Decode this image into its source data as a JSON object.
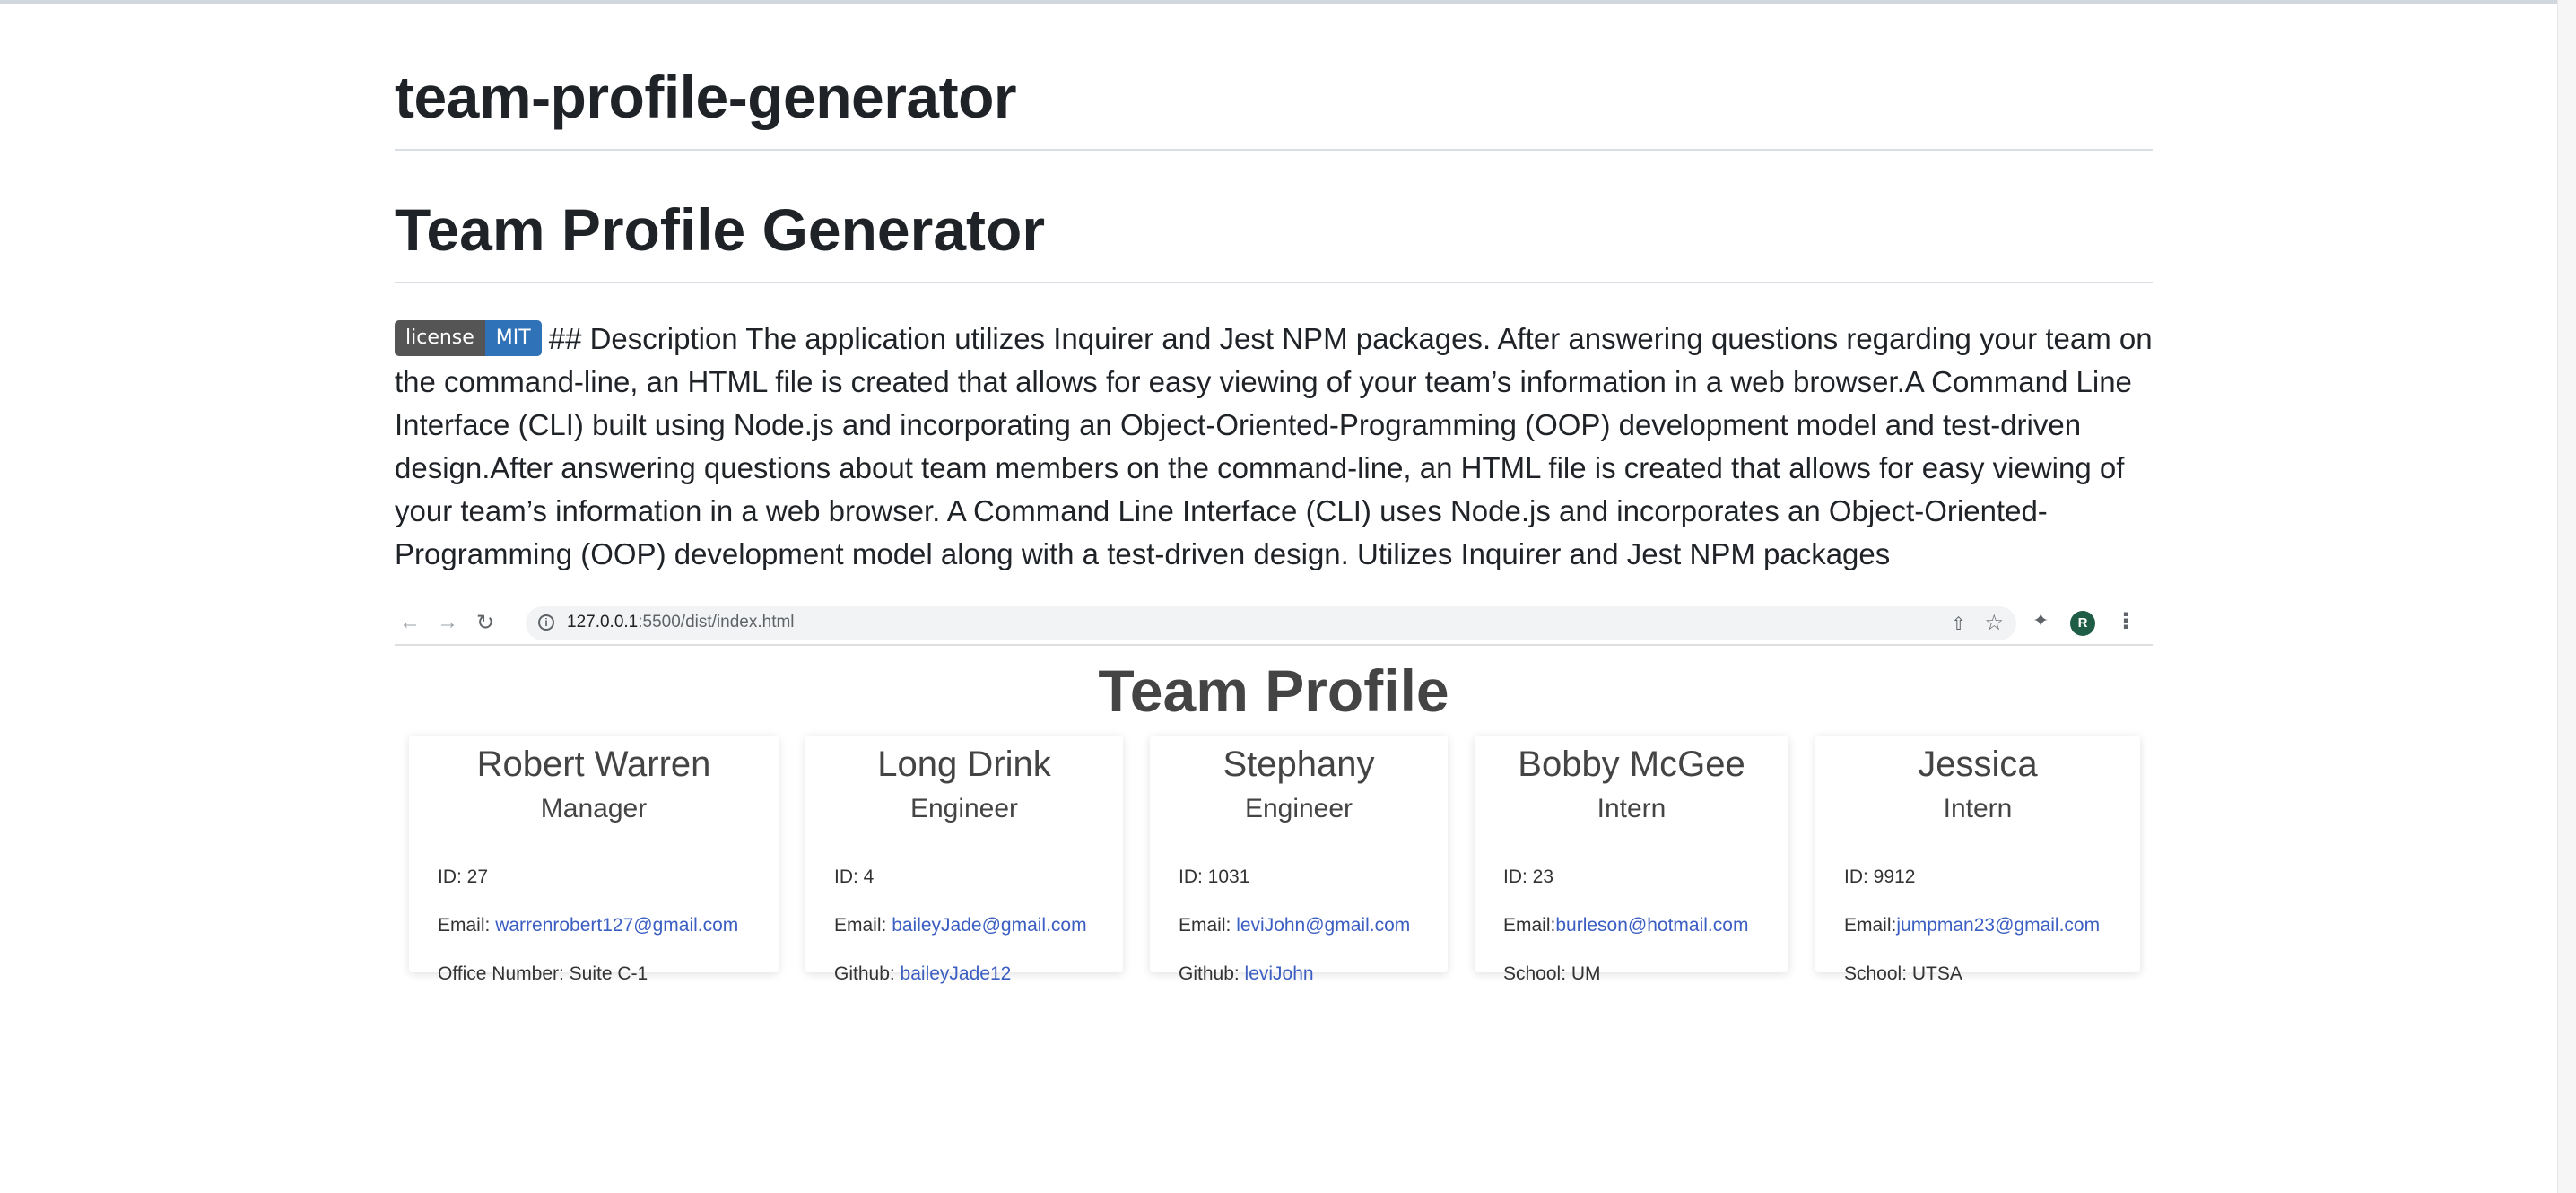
{
  "repo": {
    "title": "team-profile-generator"
  },
  "readme": {
    "heading": "Team Profile Generator",
    "badge": {
      "left": "license",
      "right": "MIT"
    },
    "description": "## Description The application utilizes Inquirer and Jest NPM packages. After answering questions regarding your team on the command-line, an HTML file is created that allows for easy viewing of your team’s information in a web browser.A Command Line Interface (CLI) built using Node.js and incorporating an Object-Oriented-Programming (OOP) development model and test-driven design.After answering questions about team members on the command-line, an HTML file is created that allows for easy viewing of your team’s information in a web browser. A Command Line Interface (CLI) uses Node.js and incorporates an Object-Oriented-Programming (OOP) development model along with a test-driven design. Utilizes Inquirer and Jest NPM packages"
  },
  "screenshot": {
    "browser": {
      "url_host": "127.0.0.1",
      "url_path": ":5500/dist/index.html",
      "profile_initial": "R",
      "icons": [
        "back-icon",
        "forward-icon",
        "reload-icon",
        "info-icon",
        "share-icon",
        "star-icon",
        "extensions-icon",
        "menu-icon"
      ]
    },
    "page_title": "Team Profile",
    "cards": [
      {
        "name": "Robert Warren",
        "role": "Manager",
        "id_label": "ID: 27",
        "email_label": "Email: ",
        "email": "warrenrobert127@gmail.com",
        "extra_label": "Office Number: Suite C-1",
        "extra_link": ""
      },
      {
        "name": "Long Drink",
        "role": "Engineer",
        "id_label": "ID: 4",
        "email_label": "Email: ",
        "email": "baileyJade@gmail.com",
        "extra_label": "Github: ",
        "extra_link": "baileyJade12"
      },
      {
        "name": "Stephany",
        "role": "Engineer",
        "id_label": "ID: 1031",
        "email_label": "Email: ",
        "email": "leviJohn@gmail.com",
        "extra_label": "Github: ",
        "extra_link": "leviJohn"
      },
      {
        "name": "Bobby McGee",
        "role": "Intern",
        "id_label": "ID: 23",
        "email_label": "Email:",
        "email": "burleson@hotmail.com",
        "extra_label": "School: UM",
        "extra_link": ""
      },
      {
        "name": "Jessica",
        "role": "Intern",
        "id_label": "ID: 9912",
        "email_label": "Email:",
        "email": "jumpman23@gmail.com",
        "extra_label": "School: UTSA",
        "extra_link": ""
      }
    ]
  }
}
